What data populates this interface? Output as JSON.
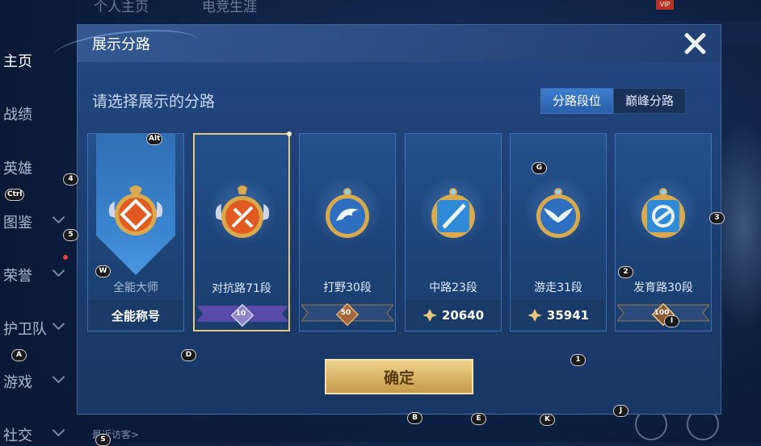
{
  "background": {
    "top_nav": [
      "个人主页",
      "电竞生涯"
    ],
    "sidebar": [
      {
        "label": "主页",
        "chevron": false
      },
      {
        "label": "战绩",
        "chevron": false
      },
      {
        "label": "英雄",
        "chevron": false
      },
      {
        "label": "图鉴",
        "chevron": true
      },
      {
        "label": "荣誉",
        "chevron": true
      },
      {
        "label": "护卫队",
        "chevron": true
      },
      {
        "label": "游戏",
        "chevron": true
      },
      {
        "label": "社交",
        "chevron": true
      }
    ],
    "visitor_label": "最近访客>",
    "vip_label": "VIP"
  },
  "dialog": {
    "title": "展示分路",
    "prompt": "请选择展示的分路",
    "tabs": [
      {
        "label": "分路段位",
        "active": true
      },
      {
        "label": "巅峰分路",
        "active": false
      }
    ],
    "cards": [
      {
        "name": "全能大师",
        "footer": "全能称号",
        "footer_type": "text",
        "emblem": "all-rounder-emblem-icon",
        "selected": false,
        "dim": true
      },
      {
        "name": "对抗路71段",
        "footer": "10",
        "footer_type": "rank",
        "emblem": "clash-lane-emblem-icon",
        "selected": true,
        "dim": false
      },
      {
        "name": "打野30段",
        "footer": "50",
        "footer_type": "rank",
        "emblem": "jungle-emblem-icon",
        "selected": false,
        "dim": false
      },
      {
        "name": "中路23段",
        "footer": "20640",
        "footer_type": "score",
        "emblem": "mid-lane-emblem-icon",
        "selected": false,
        "dim": false
      },
      {
        "name": "游走31段",
        "footer": "35941",
        "footer_type": "score",
        "emblem": "roam-emblem-icon",
        "selected": false,
        "dim": false
      },
      {
        "name": "发育路30段",
        "footer": "100",
        "footer_type": "rank",
        "emblem": "farm-lane-emblem-icon",
        "selected": false,
        "dim": false
      }
    ],
    "confirm_label": "确定"
  },
  "hotkeys": [
    "Alt",
    "4",
    "Ctrl",
    "5",
    "W",
    "A",
    "D",
    "G",
    "3",
    "2",
    "I",
    "1",
    "J",
    "B",
    "E",
    "K",
    "S"
  ],
  "colors": {
    "accent_gold": "#e8c77a",
    "tab_active": "#3f7fd0",
    "orange_emblem": "#e05a22",
    "blue_emblem": "#2f8ad8"
  }
}
